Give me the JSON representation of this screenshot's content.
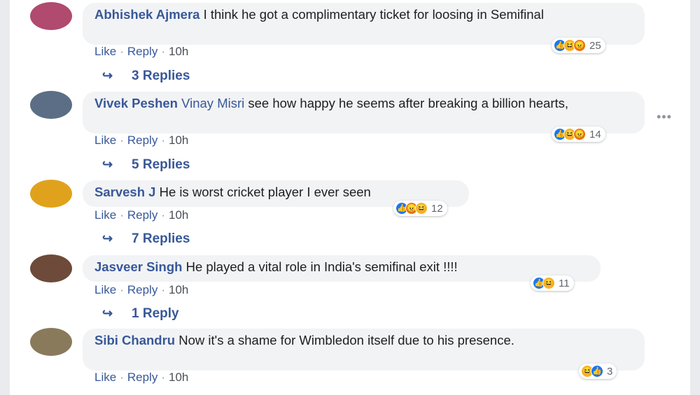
{
  "comments": [
    {
      "author": "Abhishek Ajmera",
      "tag": "",
      "text": " I think he got a complimentary ticket for loosing in Semifinal",
      "reactions": [
        "like",
        "haha",
        "angry"
      ],
      "reaction_count": "25",
      "like": "Like",
      "reply": "Reply",
      "time": "10h",
      "replies": "3 Replies",
      "avatar_color": "#b04a6e"
    },
    {
      "author": "Vivek Peshen",
      "tag": " Vinay Misri",
      "text": " see how happy he seems after breaking a billion hearts,",
      "reactions": [
        "like",
        "haha",
        "angry"
      ],
      "reaction_count": "14",
      "like": "Like",
      "reply": "Reply",
      "time": "10h",
      "replies": "5 Replies",
      "avatar_color": "#5b6e86"
    },
    {
      "author": "Sarvesh J",
      "tag": "",
      "text": " He is worst cricket player I ever seen",
      "reactions": [
        "like",
        "angry",
        "haha"
      ],
      "reaction_count": "12",
      "like": "Like",
      "reply": "Reply",
      "time": "10h",
      "replies": "7 Replies",
      "avatar_color": "#e0a21c"
    },
    {
      "author": "Jasveer Singh",
      "tag": "",
      "text": " He played a vital role in India's semifinal exit !!!!",
      "reactions": [
        "like",
        "haha"
      ],
      "reaction_count": "11",
      "like": "Like",
      "reply": "Reply",
      "time": "10h",
      "replies": "1 Reply",
      "avatar_color": "#6d4a3a"
    },
    {
      "author": "Sibi Chandru",
      "tag": "",
      "text": " Now it's a shame for Wimbledon itself due to his presence.",
      "reactions": [
        "haha",
        "like"
      ],
      "reaction_count": "3",
      "like": "Like",
      "reply": "Reply",
      "time": "10h",
      "replies": "",
      "avatar_color": "#8a7a5c"
    }
  ],
  "more_options": "•••",
  "icons": {
    "like": "👍",
    "haha": "😆",
    "angry": "😠",
    "reply_arrow": "↪"
  }
}
